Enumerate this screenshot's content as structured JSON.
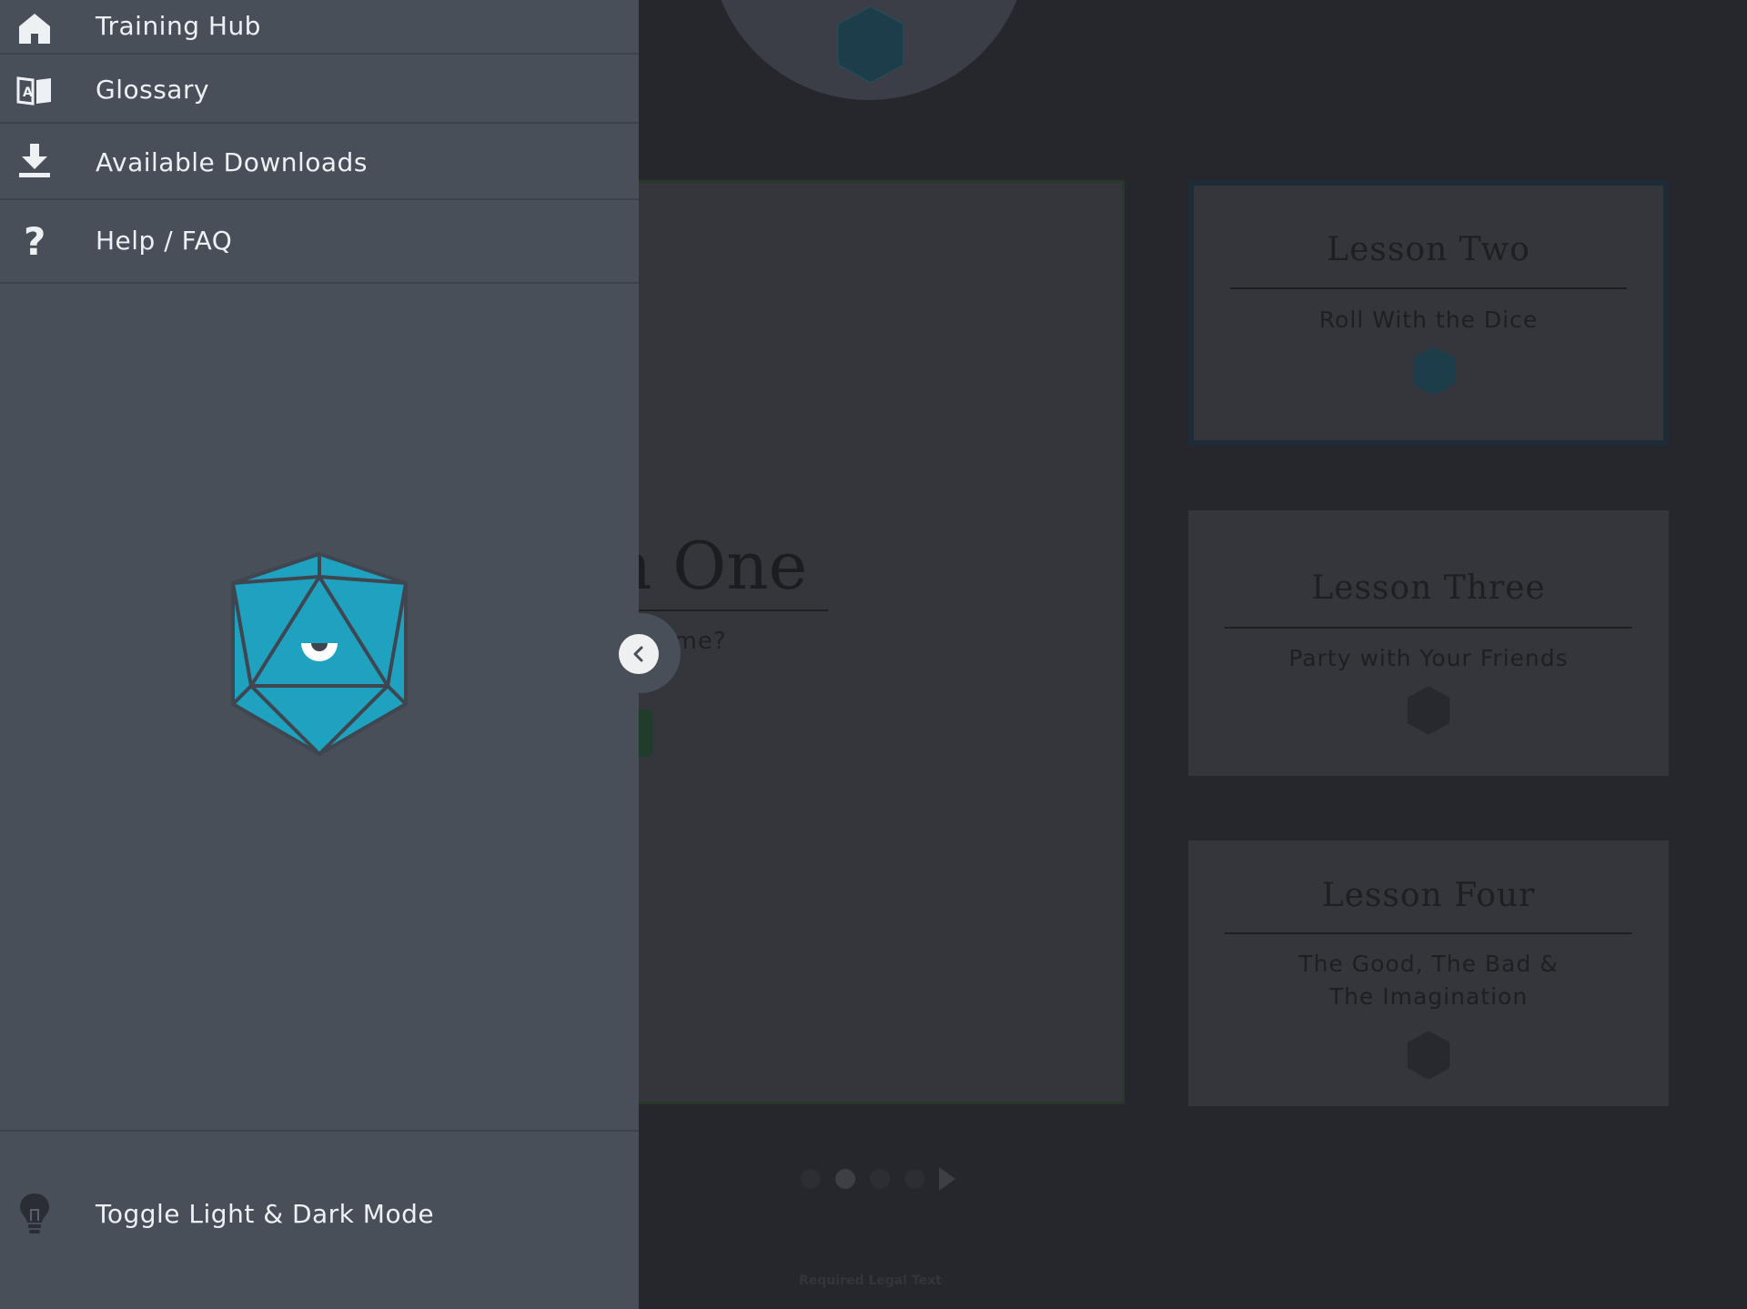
{
  "drawer": {
    "items": [
      {
        "label": "Training Hub",
        "icon": "home-icon"
      },
      {
        "label": "Glossary",
        "icon": "book-icon"
      },
      {
        "label": "Available Downloads",
        "icon": "download-icon"
      },
      {
        "label": "Help / FAQ",
        "icon": "question-icon"
      }
    ],
    "footer": {
      "label": "Toggle Light & Dark Mode",
      "icon": "lightbulb-icon"
    },
    "collapse_icon": "chevron-left-icon"
  },
  "main": {
    "featured": {
      "title": "n One",
      "subtitle": "ing Game?"
    },
    "lessons": [
      {
        "title": "Lesson Two",
        "subtitle": "Roll With the Dice"
      },
      {
        "title": "Lesson Three",
        "subtitle": "Party with Your Friends"
      },
      {
        "title": "Lesson Four",
        "subtitle": "The Good, The Bad & The Imagination"
      }
    ],
    "pager": {
      "pages": 4,
      "current": 2
    },
    "legal": "Required Legal Text"
  },
  "colors": {
    "drawer_bg": "#484f59",
    "page_bg": "#25272d",
    "accent": "#1fa2c0"
  }
}
